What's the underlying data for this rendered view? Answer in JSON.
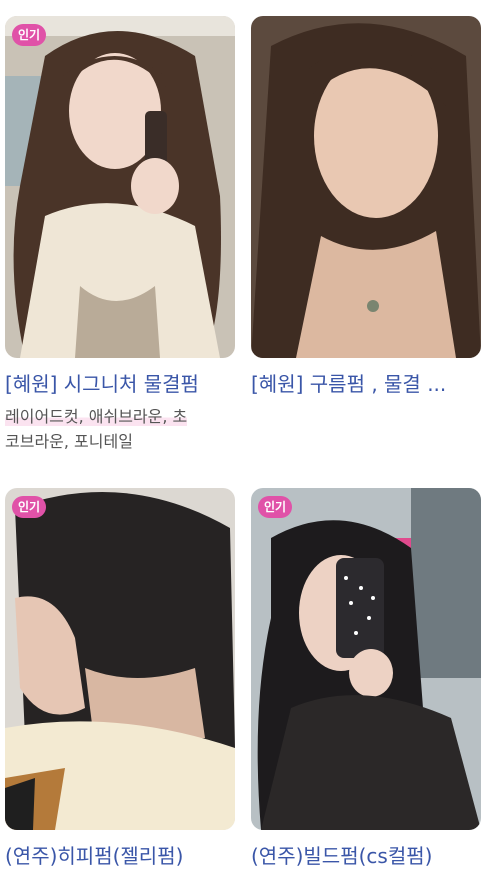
{
  "cards": [
    {
      "badge": "인기",
      "title": "[혜원] 시그니처 물결펌",
      "tags_line1": "레이어드컷, 애쉬브라운, 초",
      "tags_line2": "코브라운, 포니테일"
    },
    {
      "badge": "",
      "title": "[혜원] 구름펌 , 물결 ...",
      "tags_line1": "",
      "tags_line2": ""
    },
    {
      "badge": "인기",
      "title": "(연주)히피펌(젤리펌)",
      "tags_line1": "",
      "tags_line2": ""
    },
    {
      "badge": "인기",
      "title": "(연주)빌드펌(cs컬펌)",
      "tags_line1": "",
      "tags_line2": ""
    }
  ],
  "colors": {
    "title": "#3a56a8",
    "badge": "#e052a8",
    "tags": "#555555"
  }
}
